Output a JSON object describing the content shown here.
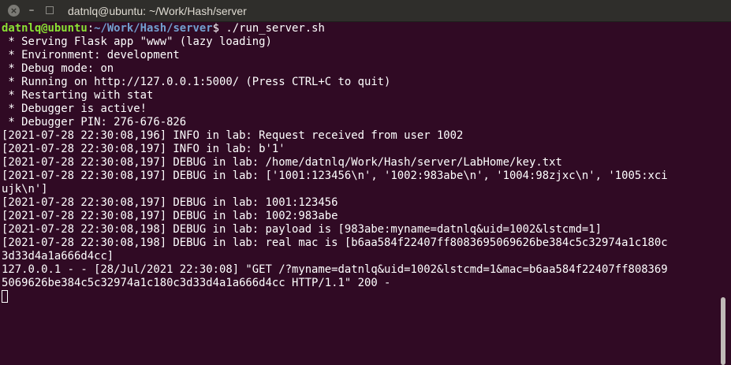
{
  "window": {
    "title": "datnlq@ubuntu: ~/Work/Hash/server",
    "close_glyph": "×",
    "minimize_glyph": "–"
  },
  "prompt": {
    "user_host": "datnlq@ubuntu",
    "separator": ":",
    "path": "~/Work/Hash/server",
    "symbol": "$ ",
    "command": "./run_server.sh"
  },
  "output": [
    " * Serving Flask app \"www\" (lazy loading)",
    " * Environment: development",
    " * Debug mode: on",
    " * Running on http://127.0.0.1:5000/ (Press CTRL+C to quit)",
    " * Restarting with stat",
    " * Debugger is active!",
    " * Debugger PIN: 276-676-826",
    "[2021-07-28 22:30:08,196] INFO in lab: Request received from user 1002",
    "[2021-07-28 22:30:08,197] INFO in lab: b'1'",
    "[2021-07-28 22:30:08,197] DEBUG in lab: /home/datnlq/Work/Hash/server/LabHome/key.txt",
    "[2021-07-28 22:30:08,197] DEBUG in lab: ['1001:123456\\n', '1002:983abe\\n', '1004:98zjxc\\n', '1005:xci",
    "ujk\\n']",
    "[2021-07-28 22:30:08,197] DEBUG in lab: 1001:123456",
    "[2021-07-28 22:30:08,197] DEBUG in lab: 1002:983abe",
    "[2021-07-28 22:30:08,198] DEBUG in lab: payload is [983abe:myname=datnlq&uid=1002&lstcmd=1]",
    "[2021-07-28 22:30:08,198] DEBUG in lab: real mac is [b6aa584f22407ff8083695069626be384c5c32974a1c180c",
    "3d33d4a1a666d4cc]",
    "127.0.0.1 - - [28/Jul/2021 22:30:08] \"GET /?myname=datnlq&uid=1002&lstcmd=1&mac=b6aa584f22407ff808369",
    "5069626be384c5c32974a1c180c3d33d4a1a666d4cc HTTP/1.1\" 200 -"
  ],
  "colors": {
    "background": "#300a24",
    "titlebar": "#2f2e2b",
    "text": "#ffffff",
    "prompt_user": "#8ae234",
    "prompt_path": "#729fcf"
  }
}
